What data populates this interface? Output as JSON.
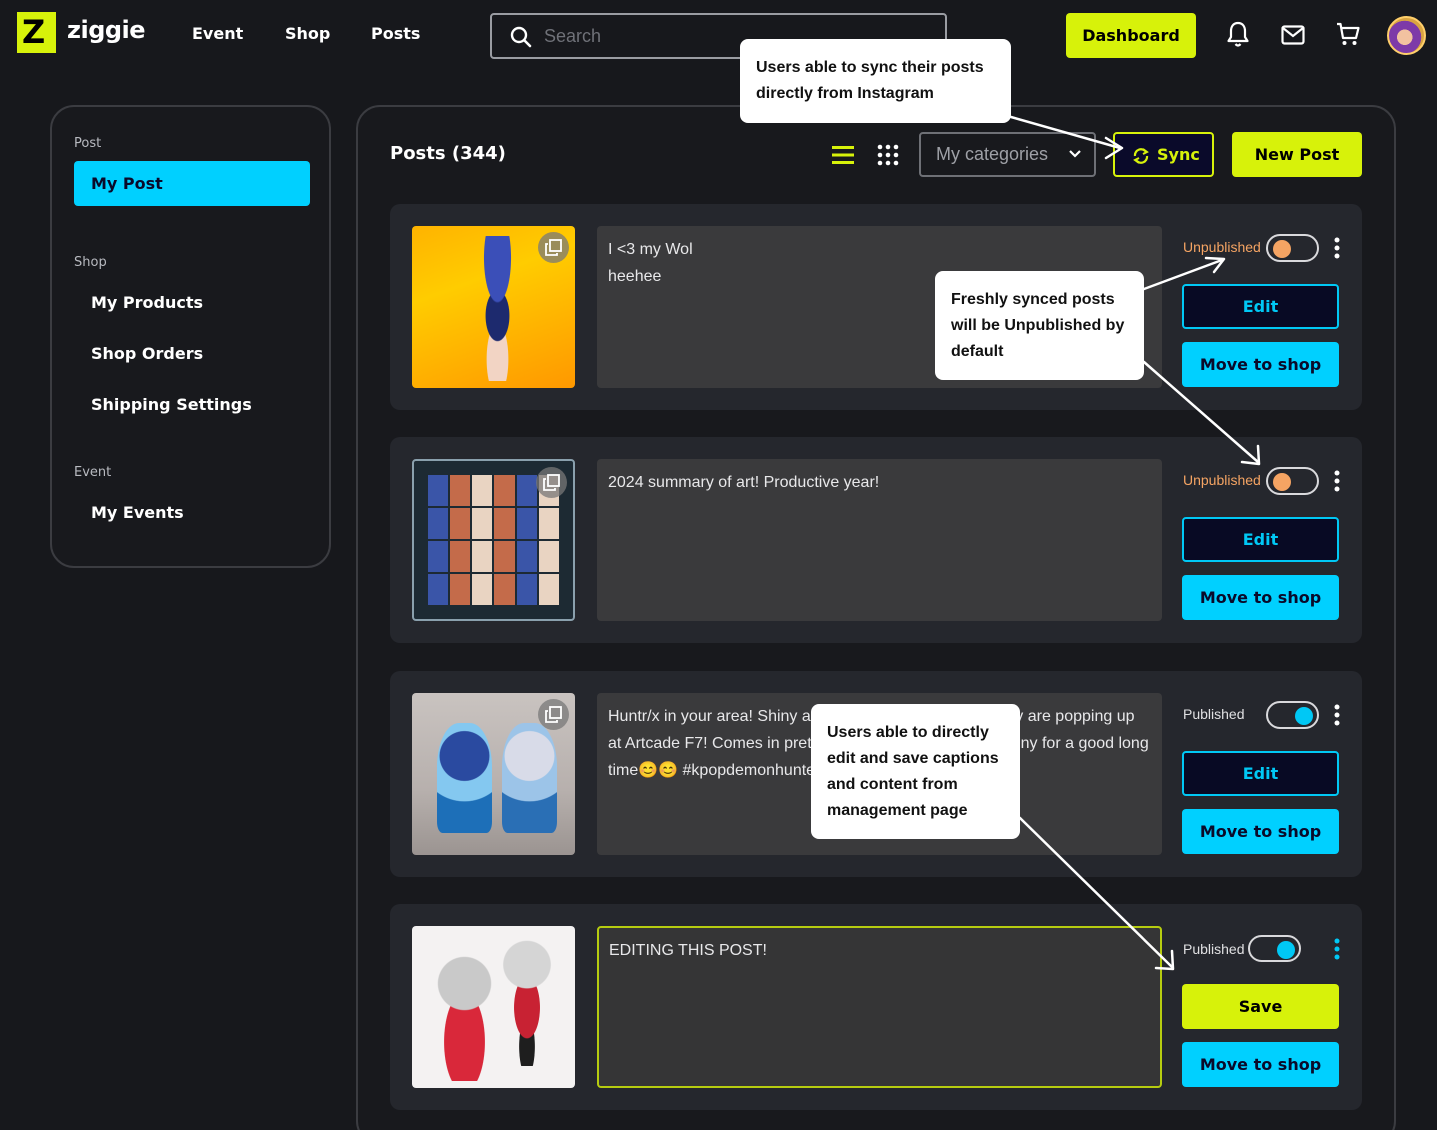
{
  "brand": {
    "logo_letter": "Z",
    "name": "ziggie"
  },
  "nav": {
    "event": "Event",
    "shop": "Shop",
    "posts": "Posts"
  },
  "search": {
    "placeholder": "Search",
    "value": ""
  },
  "header": {
    "dashboard_label": "Dashboard",
    "icons": [
      "bell-icon",
      "mail-icon",
      "cart-icon"
    ]
  },
  "sidebar": {
    "sections": [
      {
        "title": "Post",
        "items": [
          "My Post"
        ]
      },
      {
        "title": "Shop",
        "items": [
          "My Products",
          "Shop Orders",
          "Shipping Settings"
        ]
      },
      {
        "title": "Event",
        "items": [
          "My Events"
        ]
      }
    ],
    "active": "My Post"
  },
  "main": {
    "title": "Posts (344)",
    "category_select": "My categories",
    "sync_label": "Sync",
    "new_post_label": "New Post"
  },
  "posts": [
    {
      "caption": "I <3 my Wol\nheehee",
      "status": "Unpublished",
      "published": false,
      "primary_action": "Edit",
      "secondary_action": "Move to shop",
      "editing": false
    },
    {
      "caption": "2024 summary of art! Productive year!",
      "status": "Unpublished",
      "published": false,
      "primary_action": "Edit",
      "secondary_action": "Move to shop",
      "editing": false
    },
    {
      "caption": "Huntr/x in your area! Shiny acrylic stands of Mira and Zoey are popping up at Artcade F7! Comes in pretty holo, and so will remain shiny for a good long time😊😊 #kpopdemonhunters #mira #zoey #rumi",
      "status": "Published",
      "published": true,
      "primary_action": "Edit",
      "secondary_action": "Move to shop",
      "editing": false
    },
    {
      "caption": "EDITING THIS POST!",
      "status": "Published",
      "published": true,
      "primary_action": "Save",
      "secondary_action": "Move to shop",
      "editing": true
    }
  ],
  "annotations": {
    "sync_note": "Users able to sync their posts directly from Instagram",
    "unpublished_note": "Freshly synced posts will be Unpublished by default",
    "edit_note": "Users able to directly edit and save captions and content from management page"
  },
  "colors": {
    "accent_yellow": "#d7f20a",
    "accent_cyan": "#00d0ff",
    "unpublished_orange": "#f5a463",
    "background": "#17181c"
  }
}
